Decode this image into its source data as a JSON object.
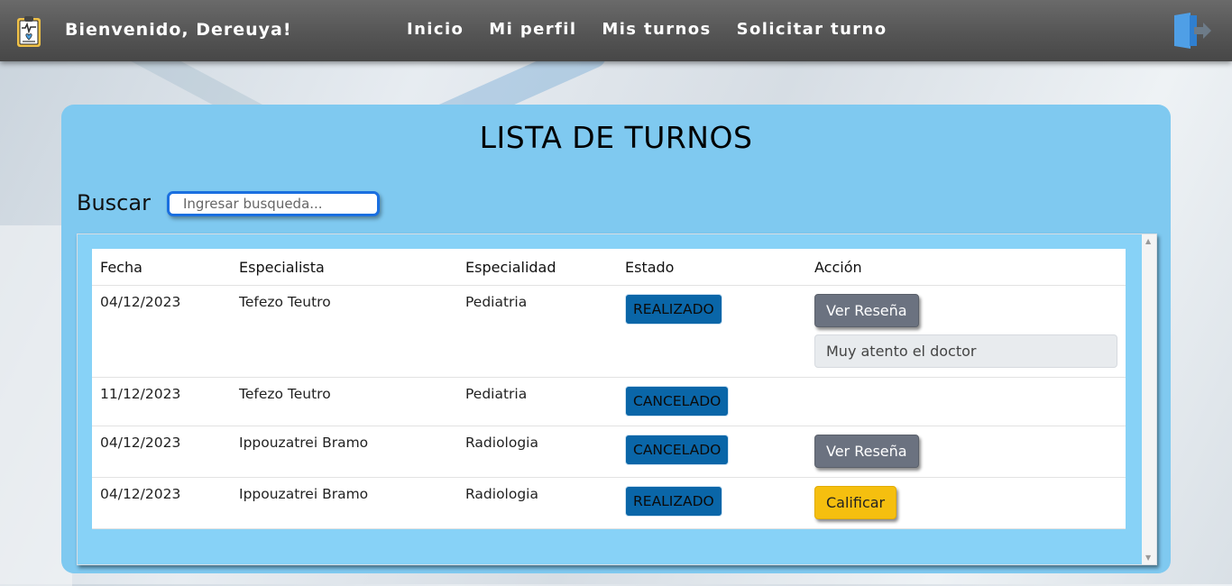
{
  "navbar": {
    "welcome": "Bienvenido, Dereuya!",
    "links": [
      "Inicio",
      "Mi perfil",
      "Mis turnos",
      "Solicitar turno"
    ]
  },
  "page": {
    "title": "LISTA DE TURNOS",
    "search_label": "Buscar",
    "search_placeholder": "Ingresar busqueda..."
  },
  "table": {
    "headers": [
      "Fecha",
      "Especialista",
      "Especialidad",
      "Estado",
      "Acción"
    ],
    "rows": [
      {
        "fecha": "04/12/2023",
        "especialista": "Tefezo Teutro",
        "especialidad": "Pediatria",
        "estado": "REALIZADO",
        "accion": "Ver Reseña",
        "resena": "Muy atento el doctor"
      },
      {
        "fecha": "11/12/2023",
        "especialista": "Tefezo Teutro",
        "especialidad": "Pediatria",
        "estado": "CANCELADO"
      },
      {
        "fecha": "04/12/2023",
        "especialista": "Ippouzatrei Bramo",
        "especialidad": "Radiologia",
        "estado": "CANCELADO",
        "accion": "Ver Reseña"
      },
      {
        "fecha": "04/12/2023",
        "especialista": "Ippouzatrei Bramo",
        "especialidad": "Radiologia",
        "estado": "REALIZADO",
        "accion": "Calificar"
      }
    ]
  },
  "colors": {
    "navbar": "#555555",
    "card": "#7fc9f0",
    "badge": "#0a66a8",
    "button_gray": "#6b7280",
    "button_yellow": "#f5bf0f",
    "search_border": "#1a6fe0"
  },
  "icons": {
    "logo": "medical-clipboard-icon",
    "logout": "logout-door-icon"
  }
}
